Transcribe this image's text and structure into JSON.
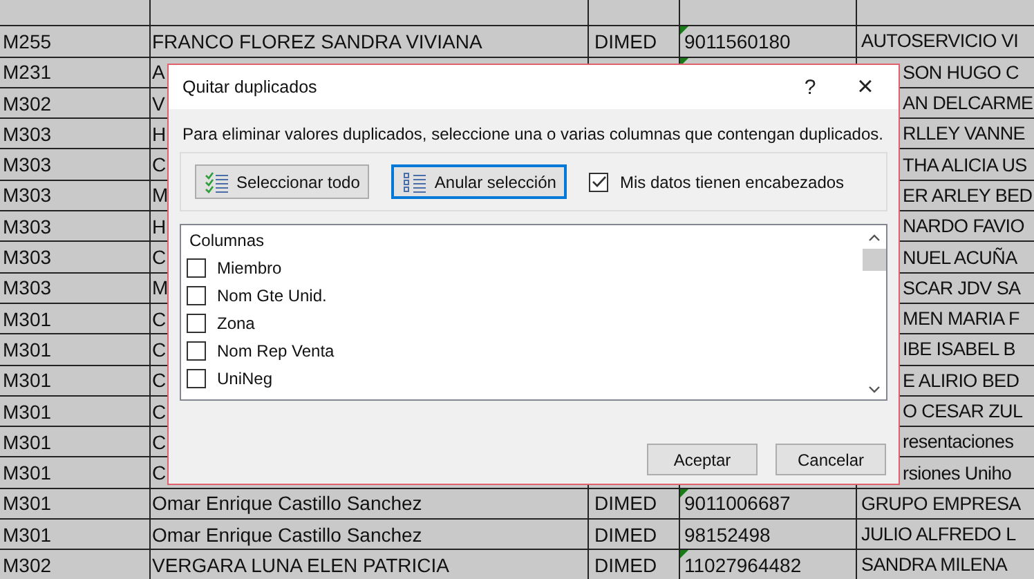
{
  "sheet": {
    "rows": [
      {
        "a": "M255",
        "b": "FRANCO FLOREZ SANDRA VIVIANA",
        "c": "DIMED",
        "d": "9011560180",
        "d_marker": true,
        "e": "AUTOSERVICIO VI"
      },
      {
        "a": "M231",
        "b": "A",
        "d_marker": true,
        "e": "SON HUGO C"
      },
      {
        "a": "M302",
        "b": "V",
        "e": "AN DELCARME"
      },
      {
        "a": "M303",
        "b": "H",
        "e": "RLLEY VANNE"
      },
      {
        "a": "M303",
        "b": "C",
        "e": "THA ALICIA US"
      },
      {
        "a": "M303",
        "b": "M",
        "e": "ER ARLEY BED"
      },
      {
        "a": "M303",
        "b": "H",
        "e": "NARDO FAVIO"
      },
      {
        "a": "M303",
        "b": "C",
        "e": "NUEL ACUÑA"
      },
      {
        "a": "M303",
        "b": "M",
        "e": "SCAR JDV SA"
      },
      {
        "a": "M301",
        "b": "C",
        "e": "MEN MARIA F"
      },
      {
        "a": "M301",
        "b": "C",
        "e": "IBE ISABEL B"
      },
      {
        "a": "M301",
        "b": "C",
        "e": "E ALIRIO BED"
      },
      {
        "a": "M301",
        "b": "C",
        "e": "O CESAR ZUL"
      },
      {
        "a": "M301",
        "b": "C",
        "e": "resentaciones"
      },
      {
        "a": "M301",
        "b": "C",
        "e": "rsiones Uniho"
      },
      {
        "a": "M301",
        "b": "Omar Enrique Castillo Sanchez",
        "c": "DIMED",
        "d": "9011006687",
        "d_marker": true,
        "e": "GRUPO EMPRESA"
      },
      {
        "a": "M301",
        "b": "Omar Enrique Castillo Sanchez",
        "c": "DIMED",
        "d": "98152498",
        "d_marker": false,
        "e": "JULIO ALFREDO L"
      },
      {
        "a": "M302",
        "b": "VERGARA LUNA ELEN PATRICIA",
        "c": "DIMED",
        "d": "11027964482",
        "d_marker": true,
        "e": "SANDRA MILENA"
      }
    ]
  },
  "dialog": {
    "title": "Quitar duplicados",
    "help": "?",
    "close": "×",
    "description": "Para eliminar valores duplicados, seleccione una o varias columnas que contengan duplicados.",
    "select_all": "Seleccionar todo",
    "unselect_all": "Anular selección",
    "headers_checkbox": {
      "label": "Mis datos tienen encabezados",
      "checked": true
    },
    "columns_header": "Columnas",
    "columns": [
      {
        "label": "Miembro",
        "checked": false
      },
      {
        "label": "Nom Gte Unid.",
        "checked": false
      },
      {
        "label": "Zona",
        "checked": false
      },
      {
        "label": "Nom Rep Venta",
        "checked": false
      },
      {
        "label": "UniNeg",
        "checked": false
      }
    ],
    "ok": "Aceptar",
    "cancel": "Cancelar"
  }
}
